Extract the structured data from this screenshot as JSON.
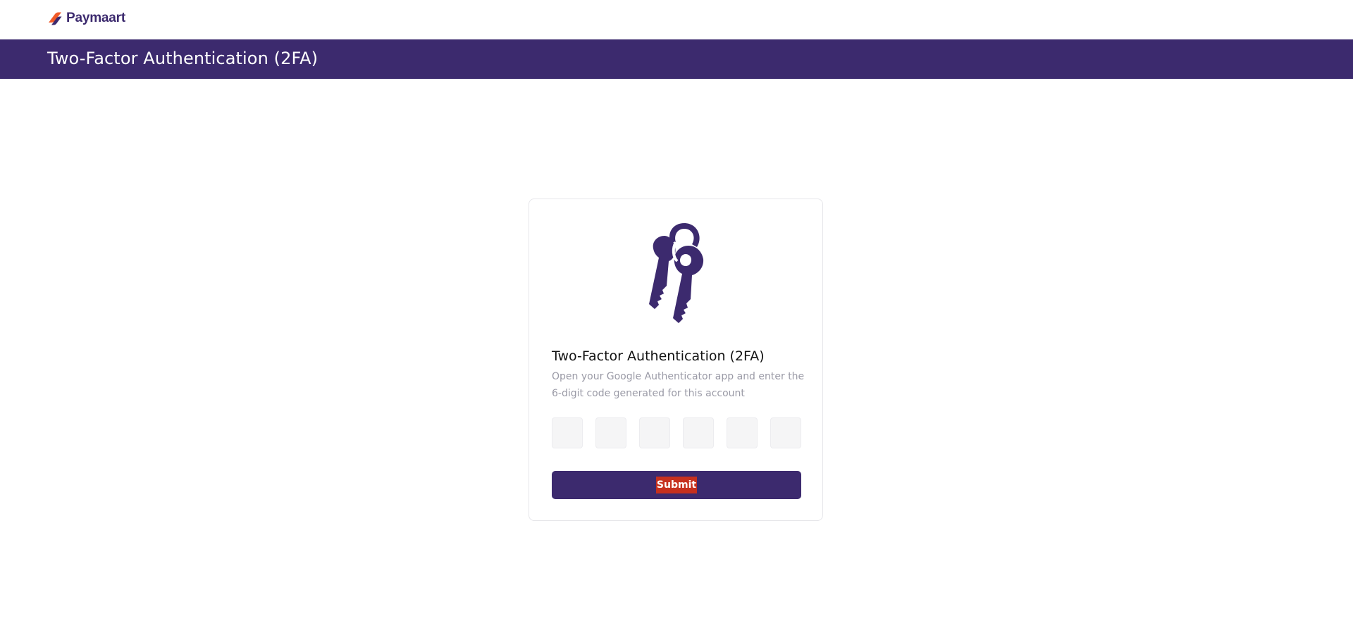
{
  "brand": {
    "name": "Paymaart",
    "logo_icon": "paymaart-logo-icon"
  },
  "banner": {
    "title": "Two-Factor Authentication (2FA)"
  },
  "card": {
    "icon": "keys-icon",
    "title": "Two-Factor Authentication (2FA)",
    "description": "Open your Google Authenticator app and enter the 6-digit code generated for this account",
    "otp": {
      "digits": [
        "",
        "",
        "",
        "",
        "",
        ""
      ]
    },
    "submit_label": "Submit"
  },
  "colors": {
    "brand_purple": "#3c2a6e",
    "logo_orange": "#f05a28",
    "submit_highlight": "#c6301e"
  }
}
